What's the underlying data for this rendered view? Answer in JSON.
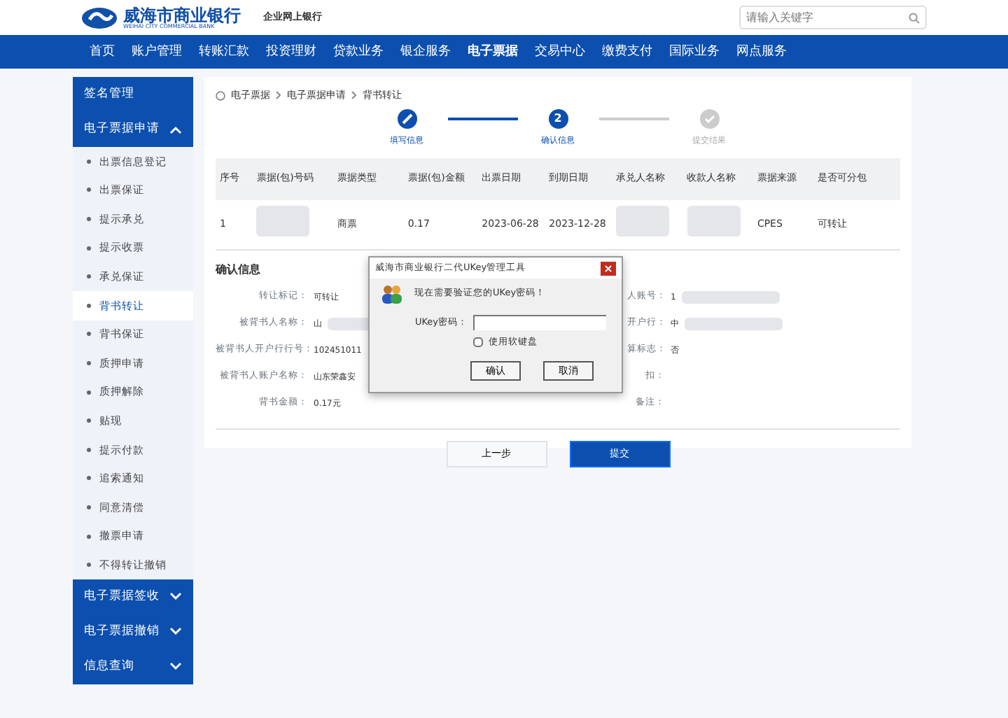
{
  "header": {
    "bank_name": "威海市商业银行",
    "bank_name_en": "WEIHAI CITY COMMERCIAL BANK",
    "site_name": "企业网上银行",
    "search": {
      "placeholder": "请输入关键字"
    }
  },
  "nav": [
    {
      "label": "首页",
      "selected": false
    },
    {
      "label": "账户管理",
      "selected": false
    },
    {
      "label": "转账汇款",
      "selected": false
    },
    {
      "label": "投资理财",
      "selected": false
    },
    {
      "label": "贷款业务",
      "selected": false
    },
    {
      "label": "银企服务",
      "selected": false
    },
    {
      "label": "电子票据",
      "selected": true
    },
    {
      "label": "交易中心",
      "selected": false
    },
    {
      "label": "缴费支付",
      "selected": false
    },
    {
      "label": "国际业务",
      "selected": false
    },
    {
      "label": "网点服务",
      "selected": false
    }
  ],
  "sidebar": [
    {
      "label": "签名管理"
    },
    {
      "label": "电子票据申请",
      "expanded": true,
      "children": [
        {
          "label": "出票信息登记",
          "selected": false
        },
        {
          "label": "出票保证",
          "selected": false
        },
        {
          "label": "提示承兑",
          "selected": false
        },
        {
          "label": "提示收票",
          "selected": false
        },
        {
          "label": "承兑保证",
          "selected": false
        },
        {
          "label": "背书转让",
          "selected": true
        },
        {
          "label": "背书保证",
          "selected": false
        },
        {
          "label": "质押申请",
          "selected": false
        },
        {
          "label": "质押解除",
          "selected": false
        },
        {
          "label": "贴现",
          "selected": false
        },
        {
          "label": "提示付款",
          "selected": false
        },
        {
          "label": "追索通知",
          "selected": false
        },
        {
          "label": "同意清偿",
          "selected": false
        },
        {
          "label": "撤票申请",
          "selected": false
        },
        {
          "label": "不得转让撤销",
          "selected": false
        }
      ]
    },
    {
      "label": "电子票据签收",
      "expanded": false
    },
    {
      "label": "电子票据撤销",
      "expanded": false
    },
    {
      "label": "信息查询",
      "expanded": false
    }
  ],
  "breadcrumb": [
    "电子票据",
    "电子票据申请",
    "背书转让"
  ],
  "steps": [
    {
      "label": "填写信息",
      "kind": "done"
    },
    {
      "label": "确认信息",
      "kind": "current",
      "number": "2"
    },
    {
      "label": "提交结果",
      "kind": "pending"
    }
  ],
  "table": {
    "columns": [
      "序号",
      "票据(包)号码",
      "票据类型",
      "票据(包)金额",
      "出票日期",
      "到期日期",
      "承兑人名称",
      "收款人名称",
      "票据来源",
      "是否可分包"
    ],
    "rows": [
      {
        "cells": [
          {
            "kind": "text",
            "text": "1"
          },
          {
            "kind": "redacted"
          },
          {
            "kind": "text",
            "text": "商票"
          },
          {
            "kind": "text",
            "text": "0.17"
          },
          {
            "kind": "text",
            "text": "2023-06-28"
          },
          {
            "kind": "text",
            "text": "2023-12-28"
          },
          {
            "kind": "redacted"
          },
          {
            "kind": "redacted"
          },
          {
            "kind": "text",
            "text": "CPES"
          },
          {
            "kind": "text",
            "text": "可转让"
          }
        ]
      }
    ]
  },
  "confirm": {
    "title": "确认信息",
    "left": [
      {
        "label": "转让标记：",
        "value": "可转让"
      },
      {
        "label": "被背书人名称：",
        "value": "山",
        "redacted": true
      },
      {
        "label": "被背书人开户行行号：",
        "value": "102451011"
      },
      {
        "label": "被背书人账户名称：",
        "value": "山东荣鑫安"
      },
      {
        "label": "背书金额：",
        "value": "0.17元"
      }
    ],
    "right": [
      {
        "label": "人账号：",
        "value": "1",
        "redacted": true
      },
      {
        "label": "开户行：",
        "value": "中",
        "redacted": true
      },
      {
        "label": "算标志：",
        "value": "否"
      },
      {
        "label": "扣："
      },
      {
        "label": "备注："
      }
    ]
  },
  "buttons": [
    {
      "label": "上一步",
      "kind": "secondary"
    },
    {
      "label": "提交",
      "kind": "primary"
    }
  ],
  "dialog": {
    "title": "威海市商业银行二代UKey管理工具",
    "message": "现在需要验证您的UKey密码！",
    "field_label": "UKey密码：",
    "soft_keyboard": {
      "label": "使用软键盘",
      "checked": false
    },
    "buttons": [
      "确认",
      "取消"
    ]
  }
}
